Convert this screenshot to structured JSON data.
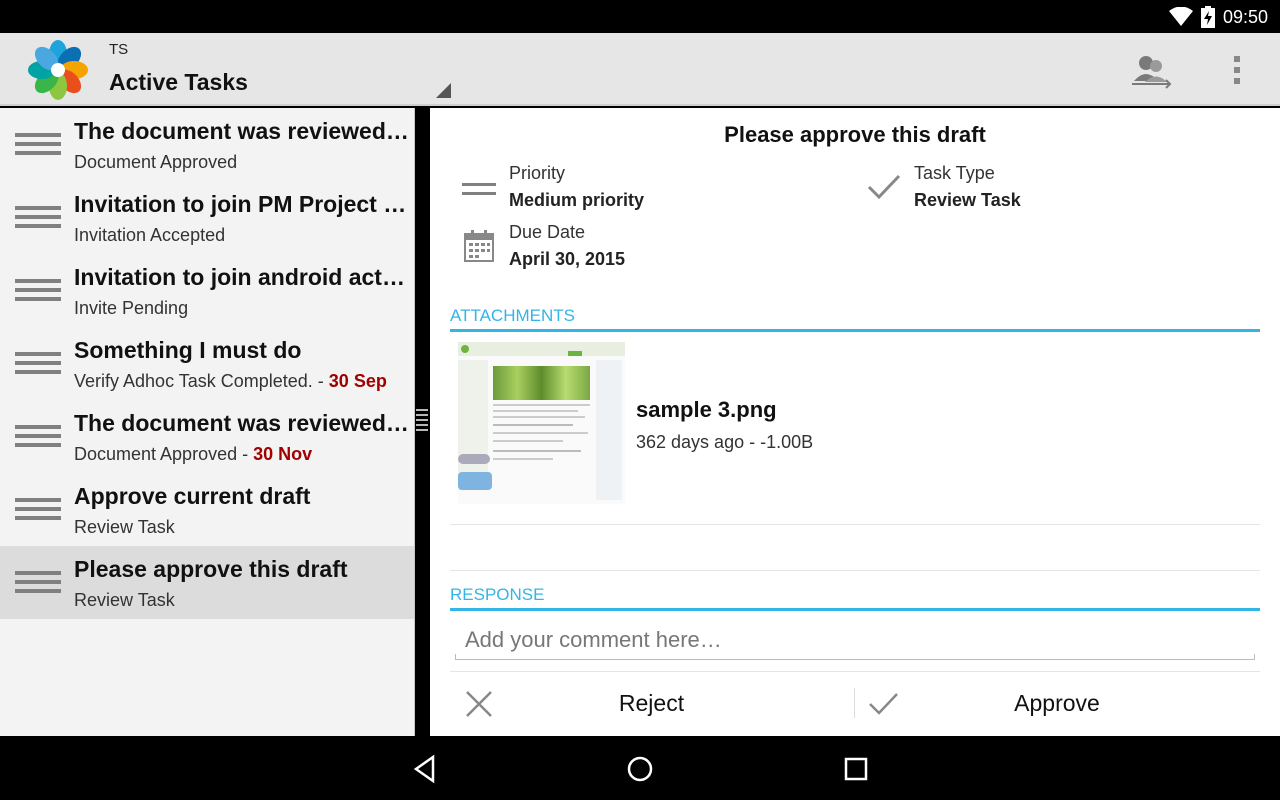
{
  "status_bar": {
    "time": "09:50",
    "icons": [
      "wifi-icon",
      "battery-charging-icon"
    ]
  },
  "action_bar": {
    "account": "TS",
    "title": "Active Tasks",
    "actions": [
      "sync-accounts-icon",
      "overflow-menu-icon"
    ]
  },
  "tasks": [
    {
      "title": "The document was reviewed and approved",
      "subtitle": "Document Approved",
      "due": ""
    },
    {
      "title": "Invitation to join PM Project - Accepted",
      "subtitle": "Invitation Accepted",
      "due": ""
    },
    {
      "title": "Invitation to join android activities",
      "subtitle": "Invite Pending",
      "due": ""
    },
    {
      "title": "Something I must do",
      "subtitle": "Verify Adhoc Task Completed. - ",
      "due": "30 Sep"
    },
    {
      "title": "The document was reviewed and approved",
      "subtitle": "Document Approved - ",
      "due": "30 Nov"
    },
    {
      "title": "Approve current draft",
      "subtitle": "Review Task",
      "due": ""
    },
    {
      "title": "Please approve this draft",
      "subtitle": "Review Task",
      "due": ""
    }
  ],
  "detail": {
    "title": "Please approve this draft",
    "priority_label": "Priority",
    "priority_value": "Medium priority",
    "task_type_label": "Task Type",
    "task_type_value": "Review Task",
    "due_label": "Due Date",
    "due_value": "April 30, 2015",
    "attachments_header": "ATTACHMENTS",
    "attachment": {
      "name": "sample 3.png",
      "meta": "362 days ago - -1.00B"
    },
    "response_header": "RESPONSE",
    "comment_placeholder": "Add your comment here…",
    "reject_label": "Reject",
    "approve_label": "Approve"
  },
  "colors": {
    "accent": "#33b5e5",
    "due_date": "#a00000",
    "selected_row": "#dcdcdc"
  }
}
